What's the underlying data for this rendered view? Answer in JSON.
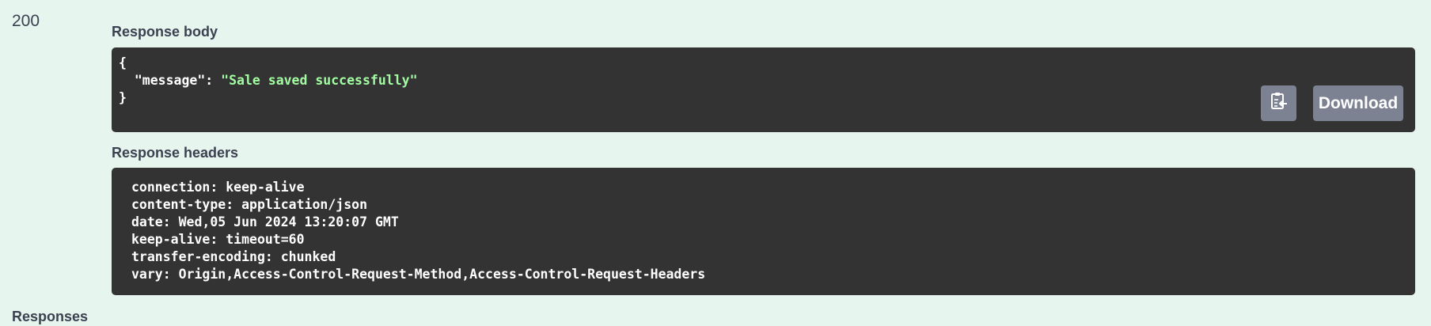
{
  "status_code": "200",
  "response_body": {
    "heading": "Response body",
    "open_brace": "{",
    "close_brace": "}",
    "key": "\"message\"",
    "separator": ": ",
    "value": "\"Sale saved successfully\"",
    "copy_icon": "clipboard-copy-icon",
    "download_label": "Download"
  },
  "response_headers": {
    "heading": "Response headers",
    "lines": [
      "connection: keep-alive",
      "content-type: application/json",
      "date: Wed,05 Jun 2024 13:20:07 GMT",
      "keep-alive: timeout=60",
      "transfer-encoding: chunked",
      "vary: Origin,Access-Control-Request-Method,Access-Control-Request-Headers"
    ]
  },
  "responses_heading": "Responses",
  "colors": {
    "background": "#e6f5ee",
    "code_panel": "#333333",
    "button": "#7d8293",
    "json_string": "#a2fca2",
    "heading_text": "#3b4151"
  }
}
